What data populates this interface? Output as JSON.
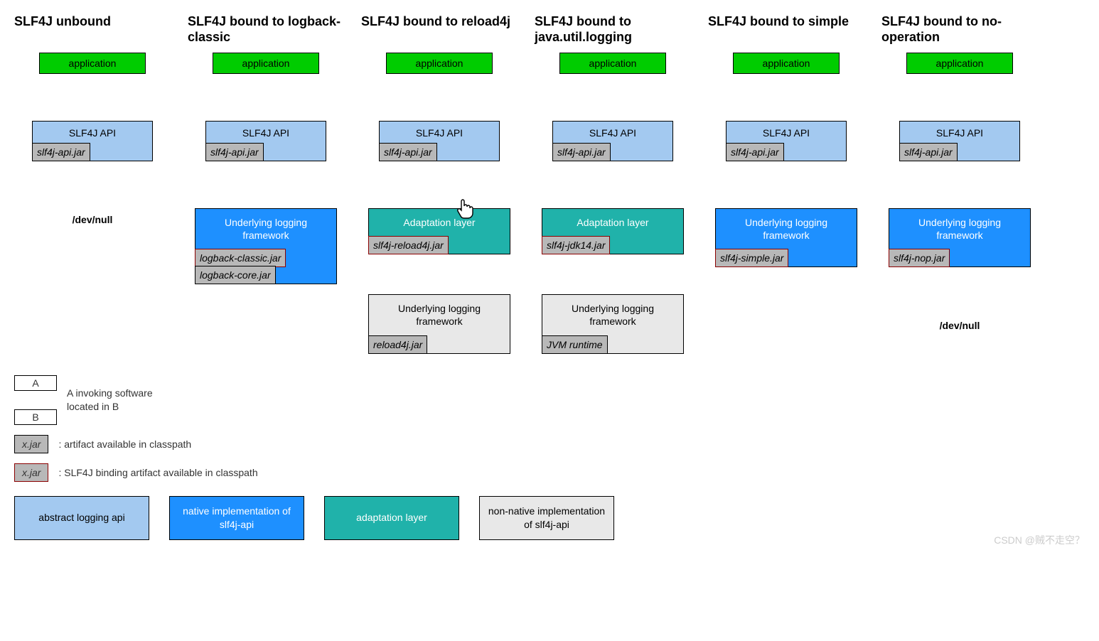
{
  "columns": [
    {
      "title": "SLF4J unbound",
      "app": "application",
      "api": "SLF4J API",
      "api_jar": "slf4j-api.jar",
      "end": "/dev/null"
    },
    {
      "title": "SLF4J bound to logback-classic",
      "app": "application",
      "api": "SLF4J API",
      "api_jar": "slf4j-api.jar",
      "fw_label": "Underlying logging framework",
      "fw_class": "blue-box",
      "fw_jars": [
        "logback-classic.jar",
        "logback-core.jar"
      ],
      "fw_jar_red": [
        true,
        false
      ]
    },
    {
      "title": "SLF4J bound to reload4j",
      "app": "application",
      "api": "SLF4J API",
      "api_jar": "slf4j-api.jar",
      "fw_label": "Adaptation layer",
      "fw_class": "teal-box",
      "fw_jars": [
        "slf4j-reload4j.jar"
      ],
      "fw_jar_red": [
        true
      ],
      "fw2_label": "Underlying logging framework",
      "fw2_jars": [
        "reload4j.jar"
      ]
    },
    {
      "title": "SLF4J bound to java.util.logging",
      "app": "application",
      "api": "SLF4J API",
      "api_jar": "slf4j-api.jar",
      "fw_label": "Adaptation layer",
      "fw_class": "teal-box",
      "fw_jars": [
        "slf4j-jdk14.jar"
      ],
      "fw_jar_red": [
        true
      ],
      "fw2_label": "Underlying logging framework",
      "fw2_jars": [
        "JVM runtime"
      ]
    },
    {
      "title": "SLF4J bound to simple",
      "app": "application",
      "api": "SLF4J API",
      "api_jar": "slf4j-api.jar",
      "fw_label": "Underlying logging framework",
      "fw_class": "blue-box",
      "fw_jars": [
        "slf4j-simple.jar"
      ],
      "fw_jar_red": [
        true
      ]
    },
    {
      "title": "SLF4J bound to no-operation",
      "app": "application",
      "api": "SLF4J API",
      "api_jar": "slf4j-api.jar",
      "fw_label": "Underlying logging framework",
      "fw_class": "blue-box",
      "fw_jars": [
        "slf4j-nop.jar"
      ],
      "fw_jar_red": [
        true
      ],
      "end": "/dev/null"
    }
  ],
  "legend": {
    "a": "A",
    "b": "B",
    "ab_text": "A invoking software located in B",
    "jar_plain": "x.jar",
    "jar_plain_text": ": artifact available in classpath",
    "jar_red": "x.jar",
    "jar_red_text": ": SLF4J binding artifact available in classpath",
    "sw_light": "abstract logging api",
    "sw_blue": "native implementation of slf4j-api",
    "sw_teal": "adaptation layer",
    "sw_grey": "non-native implementation of slf4j-api"
  },
  "watermark": "CSDN @贼不走空？"
}
